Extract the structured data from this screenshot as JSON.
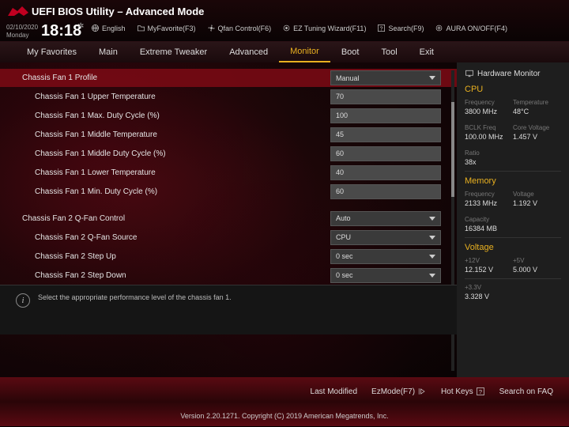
{
  "header": {
    "title": "UEFI BIOS Utility – Advanced Mode",
    "date": "02/10/2020",
    "day": "Monday",
    "time": "18:18",
    "topbar": {
      "lang": "English",
      "fav": "MyFavorite(F3)",
      "qfan": "Qfan Control(F6)",
      "ez": "EZ Tuning Wizard(F11)",
      "search": "Search(F9)",
      "aura": "AURA ON/OFF(F4)"
    }
  },
  "tabs": [
    "My Favorites",
    "Main",
    "Extreme Tweaker",
    "Advanced",
    "Monitor",
    "Boot",
    "Tool",
    "Exit"
  ],
  "settings": [
    {
      "label": "Chassis Fan 1 Profile",
      "type": "dropdown",
      "value": "Manual",
      "header": true
    },
    {
      "label": "Chassis Fan 1 Upper Temperature",
      "type": "text",
      "value": "70",
      "indent": true
    },
    {
      "label": "Chassis Fan 1 Max. Duty Cycle (%)",
      "type": "text",
      "value": "100",
      "indent": true
    },
    {
      "label": "Chassis Fan 1 Middle Temperature",
      "type": "text",
      "value": "45",
      "indent": true
    },
    {
      "label": "Chassis Fan 1 Middle Duty Cycle (%)",
      "type": "text",
      "value": "60",
      "indent": true
    },
    {
      "label": "Chassis Fan 1 Lower Temperature",
      "type": "text",
      "value": "40",
      "indent": true
    },
    {
      "label": "Chassis Fan 1 Min. Duty Cycle (%)",
      "type": "text",
      "value": "60",
      "indent": true
    },
    {
      "label": "Chassis Fan 2 Q-Fan Control",
      "type": "dropdown",
      "value": "Auto"
    },
    {
      "label": "Chassis Fan 2 Q-Fan Source",
      "type": "dropdown",
      "value": "CPU",
      "indent": true
    },
    {
      "label": "Chassis Fan 2 Step Up",
      "type": "dropdown",
      "value": "0 sec",
      "indent": true
    },
    {
      "label": "Chassis Fan 2 Step Down",
      "type": "dropdown",
      "value": "0 sec",
      "indent": true
    }
  ],
  "help": "Select the appropriate performance level of the chassis fan 1.",
  "sidebar": {
    "title": "Hardware Monitor",
    "cpu": {
      "heading": "CPU",
      "freq_l": "Frequency",
      "freq": "3800 MHz",
      "temp_l": "Temperature",
      "temp": "48°C",
      "bclk_l": "BCLK Freq",
      "bclk": "100.00 MHz",
      "cv_l": "Core Voltage",
      "cv": "1.457 V",
      "ratio_l": "Ratio",
      "ratio": "38x"
    },
    "mem": {
      "heading": "Memory",
      "freq_l": "Frequency",
      "freq": "2133 MHz",
      "volt_l": "Voltage",
      "volt": "1.192 V",
      "cap_l": "Capacity",
      "cap": "16384 MB"
    },
    "volt": {
      "heading": "Voltage",
      "v12_l": "+12V",
      "v12": "12.152 V",
      "v5_l": "+5V",
      "v5": "5.000 V",
      "v33_l": "+3.3V",
      "v33": "3.328 V"
    }
  },
  "footer": {
    "last": "Last Modified",
    "ez": "EzMode(F7)",
    "hot": "Hot Keys",
    "faq": "Search on FAQ",
    "copyright": "Version 2.20.1271. Copyright (C) 2019 American Megatrends, Inc."
  }
}
